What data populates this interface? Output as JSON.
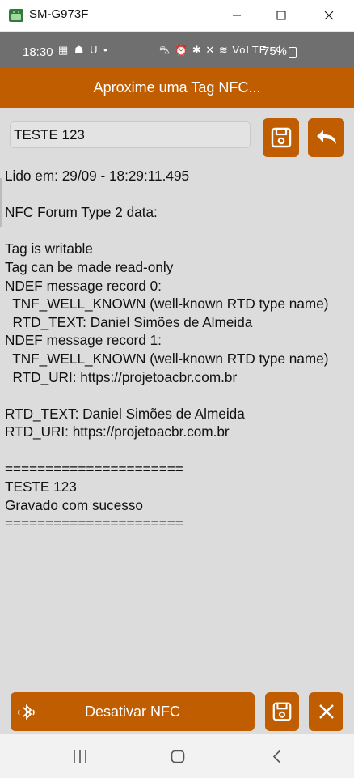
{
  "window": {
    "title": "SM-G973F"
  },
  "statusbar": {
    "time": "18:30",
    "left_icons": "▦ ☗ U •",
    "right_icons": "⛍ ⏰ ✱ ✕ ≋ VoLTE .ıl",
    "battery": "75%"
  },
  "appbar": {
    "title": "Aproxime uma Tag NFC..."
  },
  "input": {
    "value": "TESTE 123"
  },
  "log": {
    "lines": [
      "Lido em: 29/09 - 18:29:11.495",
      "",
      "NFC Forum Type 2 data:",
      "",
      "Tag is writable",
      "Tag can be made read-only",
      "NDEF message record 0:",
      "  TNF_WELL_KNOWN (well-known RTD type name)",
      "  RTD_TEXT: Daniel Simões de Almeida",
      "NDEF message record 1:",
      "  TNF_WELL_KNOWN (well-known RTD type name)",
      "  RTD_URI: https://projetoacbr.com.br",
      "",
      "RTD_TEXT: Daniel Simões de Almeida",
      "RTD_URI: https://projetoacbr.com.br",
      "",
      "======================",
      "TESTE 123",
      "Gravado com sucesso",
      "======================"
    ]
  },
  "footer": {
    "nfc_button_label": "Desativar NFC"
  },
  "colors": {
    "accent": "#c05d00",
    "content_bg": "#dcdcdc",
    "statusbar": "#6f6f6f"
  },
  "icons": {
    "window": [
      "android-app-icon",
      "minimize-icon",
      "maximize-icon",
      "close-icon"
    ],
    "toolbar": [
      "save-icon",
      "undo-icon"
    ],
    "footer": [
      "bluetooth-nfc-icon",
      "save-icon",
      "close-icon"
    ],
    "navbar": [
      "recent-apps-icon",
      "home-icon",
      "back-icon"
    ]
  }
}
